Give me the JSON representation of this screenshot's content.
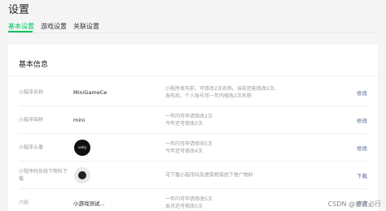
{
  "header": {
    "title": "设置"
  },
  "tabs": [
    {
      "label": "基本设置",
      "active": true
    },
    {
      "label": "游戏设置",
      "active": false
    },
    {
      "label": "关联设置",
      "active": false
    }
  ],
  "section": {
    "title": "基本信息"
  },
  "rows": [
    {
      "label": "小程序名称",
      "value": "MiniGameCe",
      "desc": [
        "小程序发布前，可修改2次名称。当前还能修改2次。",
        "发布后，个人账号可一年内修改2次名称"
      ],
      "action": "修改"
    },
    {
      "label": "小程序简称",
      "value": "mini",
      "desc": [
        "一年内可申请修改2次",
        "今年还可修改2次"
      ],
      "action": "修改"
    },
    {
      "label": "小程序头像",
      "avatar_text": "unity",
      "desc": [
        "一年内可申请修改5次",
        "今年还可修改4次"
      ],
      "action": "修改"
    },
    {
      "label": "小程序码及线下物料下载",
      "desc": [
        "可下载小程序码及搜索框等线下推广物料"
      ],
      "action": "下载"
    },
    {
      "label": "介绍",
      "value": "小游戏测试...",
      "desc": [
        "一年内可申请修改5次",
        "本月还可修改5次"
      ],
      "action": "修改"
    }
  ],
  "watermark": "CSDN @奋宫必行",
  "colors": {
    "accent": "#07c160",
    "link": "#576b95"
  }
}
